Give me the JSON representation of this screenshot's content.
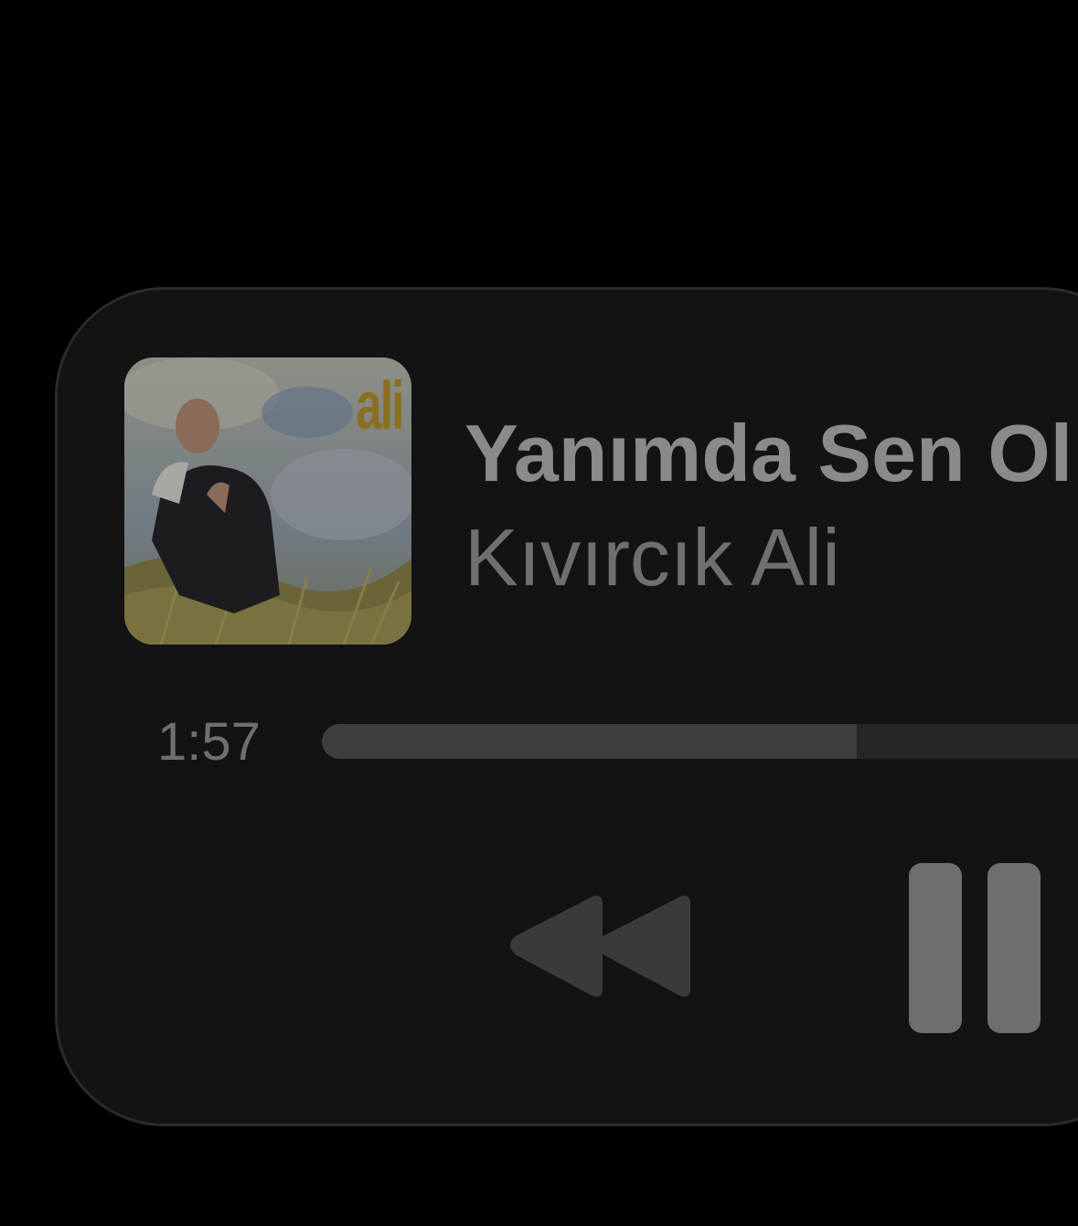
{
  "now_playing": {
    "title": "Yanımda Sen Ol",
    "artist": "Kıvırcık Ali",
    "artwork": {
      "logo_text": "ali"
    },
    "elapsed_time": "1:57",
    "progress": 0.68
  },
  "controls": {
    "rewind_icon": "rewind-icon",
    "pause_icon": "pause-icon"
  },
  "colors": {
    "background": "#000000",
    "card": "#131313",
    "title_text": "#8a8a8a",
    "secondary_text": "#6f6f6f",
    "progress_fill": "#3e3e3e",
    "progress_track": "#252525",
    "controls": "#6e6e6e",
    "artwork_logo": "#8a6f1e"
  }
}
